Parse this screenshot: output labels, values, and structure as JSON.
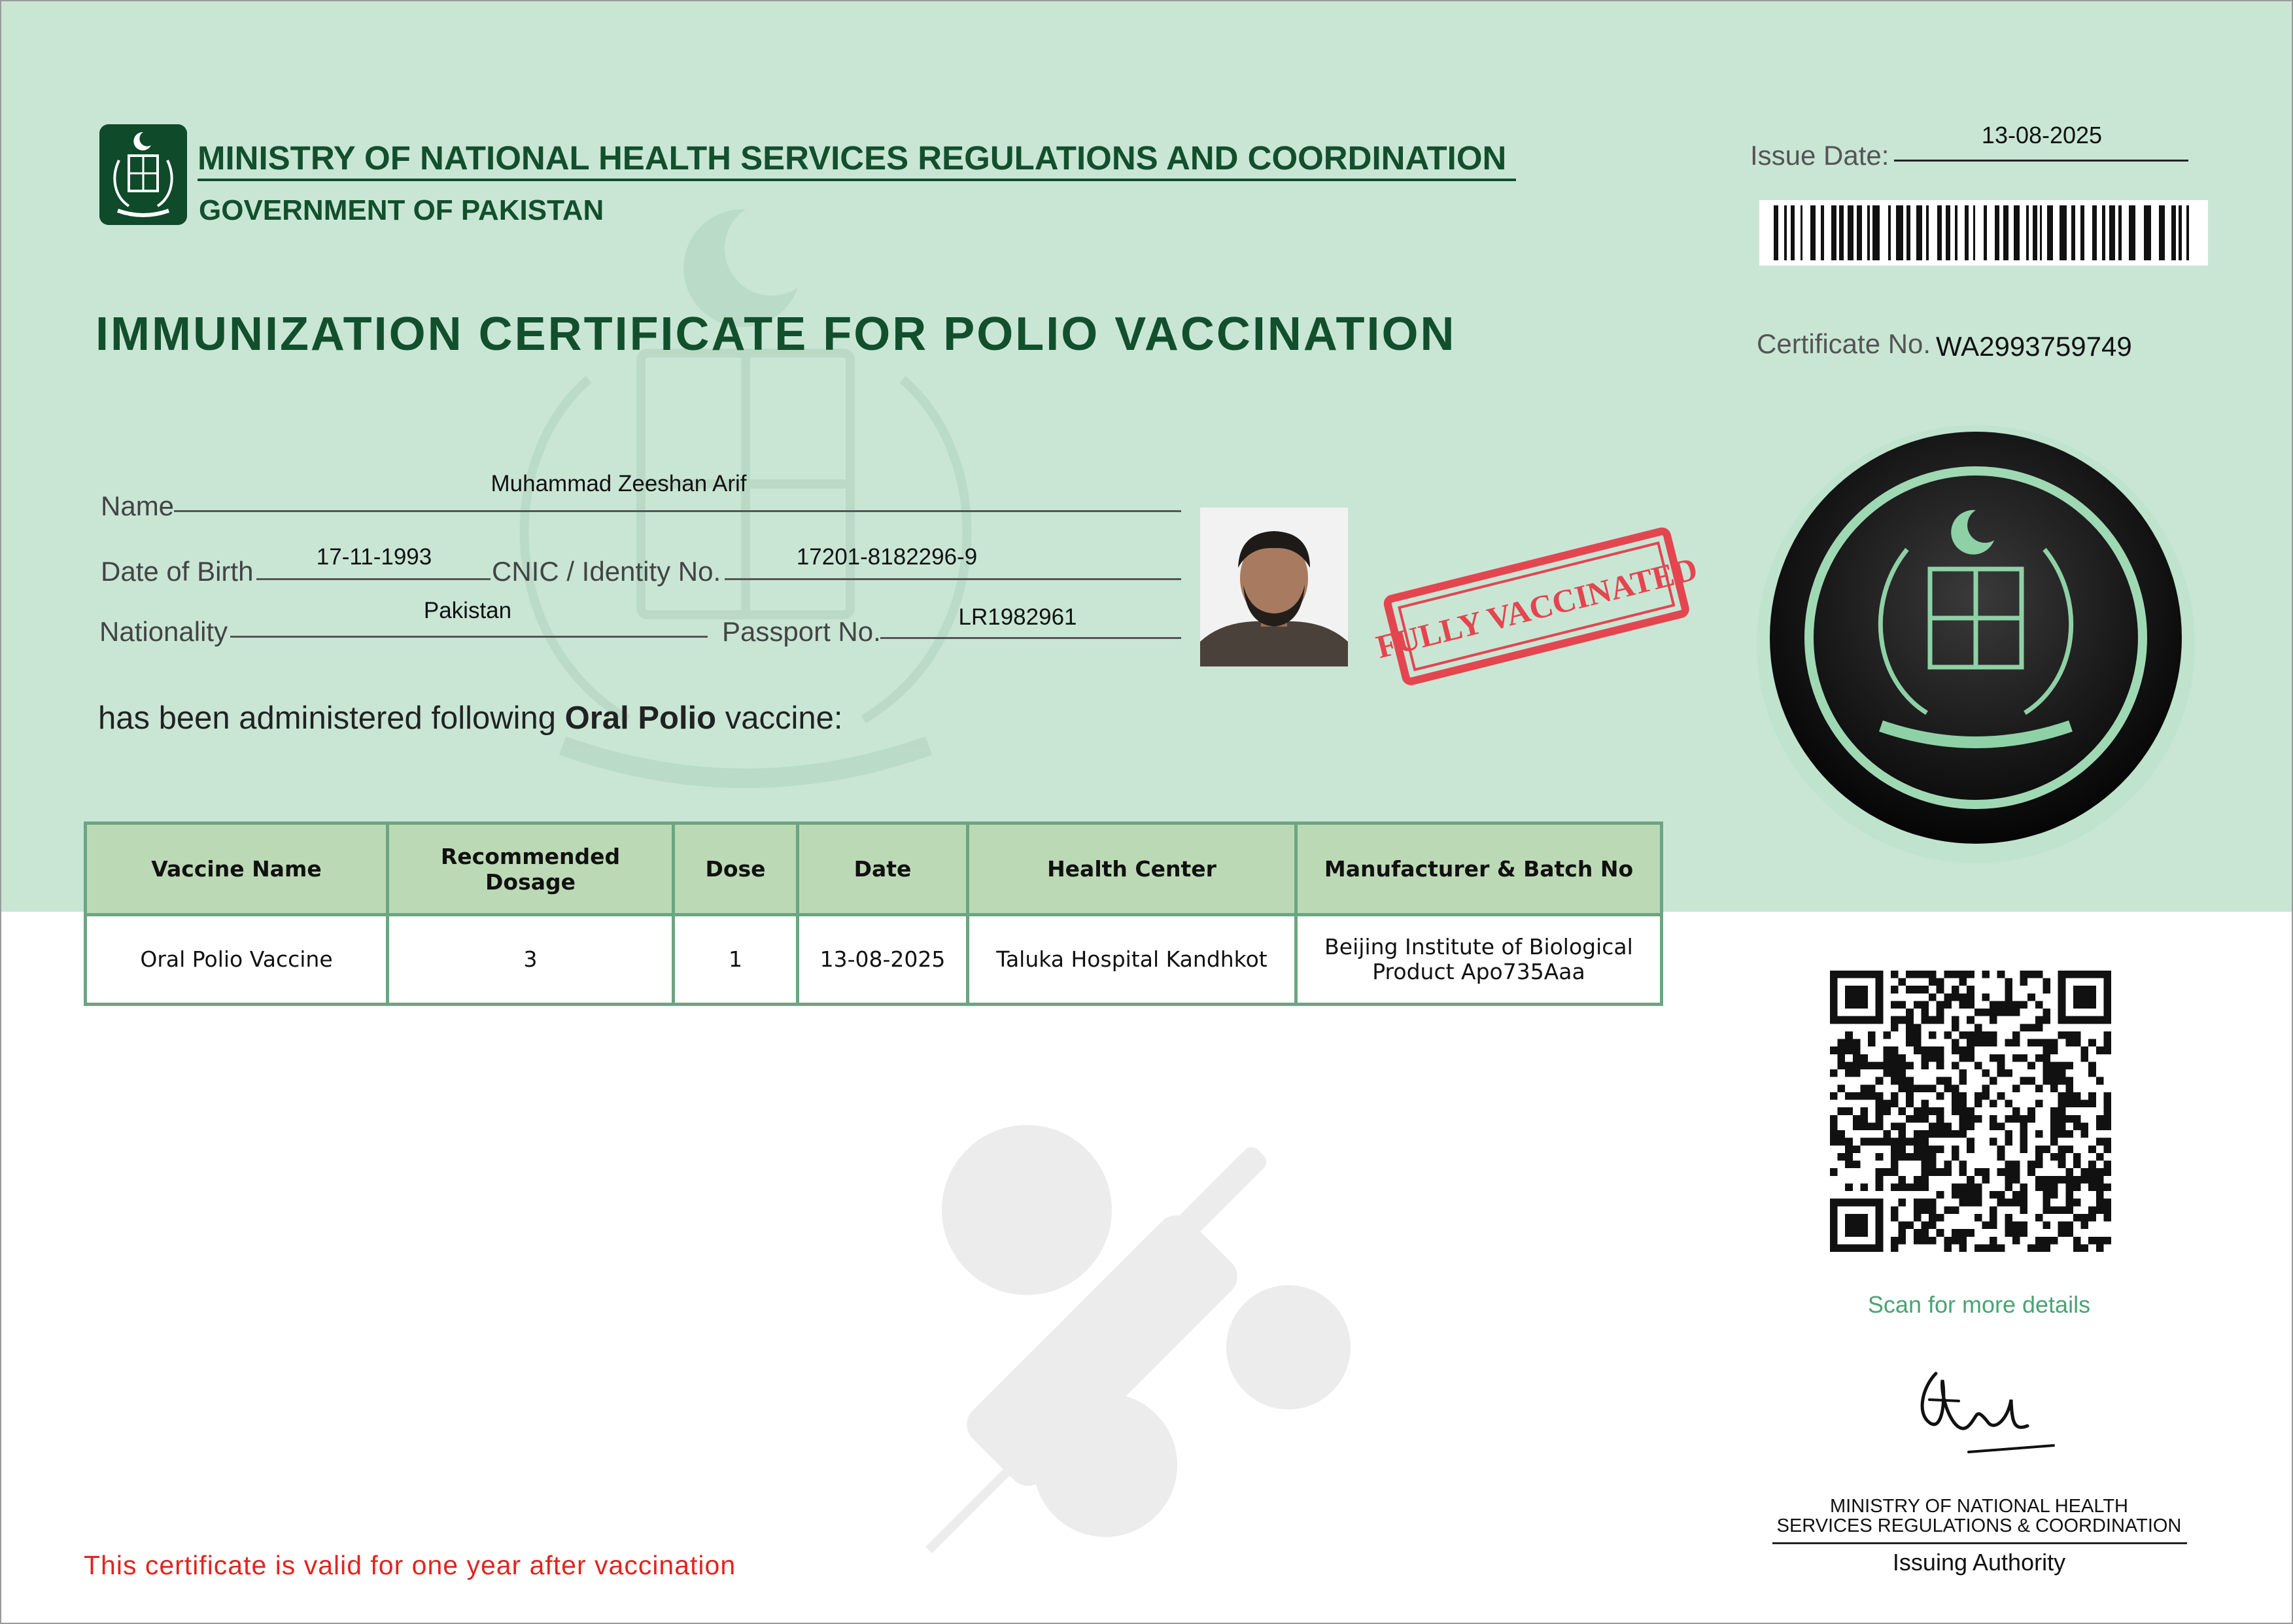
{
  "header": {
    "ministry": "MINISTRY OF NATIONAL HEALTH SERVICES REGULATIONS AND COORDINATION",
    "government": "GOVERNMENT OF PAKISTAN",
    "certificate_title": "IMMUNIZATION CERTIFICATE FOR POLIO VACCINATION"
  },
  "issue": {
    "date_label": "Issue Date:",
    "date_value": "13-08-2025",
    "cert_no_label": "Certificate No.",
    "cert_no_value": "WA2993759749"
  },
  "person": {
    "name_label": "Name",
    "name_value": "Muhammad Zeeshan Arif",
    "dob_label": "Date of Birth",
    "dob_value": "17-11-1993",
    "cnic_label": "CNIC / Identity No.",
    "cnic_value": "17201-8182296-9",
    "nationality_label": "Nationality",
    "nationality_value": "Pakistan",
    "passport_label": "Passport No.",
    "passport_value": "LR1982961"
  },
  "stamp": "FULLY VACCINATED",
  "statement": {
    "prefix": "has been administered following ",
    "vaccine": "Oral Polio",
    "suffix": " vaccine:"
  },
  "table": {
    "headers": [
      "Vaccine Name",
      "Recommended Dosage",
      "Dose",
      "Date",
      "Health Center",
      "Manufacturer & Batch No"
    ],
    "row": [
      "Oral Polio Vaccine",
      "3",
      "1",
      "13-08-2025",
      "Taluka Hospital Kandhkot",
      "Beijing Institute of Biological Product Apo735Aaa"
    ]
  },
  "qr": {
    "caption": "Scan for more details"
  },
  "issuer": {
    "line1": "MINISTRY OF NATIONAL HEALTH",
    "line2": "SERVICES REGULATIONS & COORDINATION",
    "title": "Issuing Authority"
  },
  "validity": "This certificate is valid for one year after vaccination",
  "colors": {
    "band": "#c9e6d5",
    "title_green": "#124f2d",
    "table_border": "#6aa681",
    "table_header": "#bcd9b5",
    "validity_red": "#e0251f",
    "scan_green": "#4aa374"
  },
  "icons": [
    "pakistan-emblem-icon",
    "barcode-icon",
    "qr-code-icon",
    "government-seal-icon",
    "syringe-watermark-icon"
  ]
}
